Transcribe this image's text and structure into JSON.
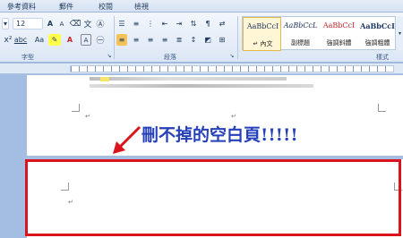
{
  "ribbon_tabs": [
    "參考資料",
    "郵件",
    "校閱",
    "檢視"
  ],
  "font": {
    "size": "12",
    "grow_label": "A",
    "shrink_label": "A",
    "format_label": "Aa",
    "clear_label": "A",
    "group_label": "字型"
  },
  "paragraph": {
    "group_label": "段落"
  },
  "styles": {
    "group_label": "樣式",
    "items": [
      {
        "sample": "AaBbCcI",
        "name": "↵ 內文"
      },
      {
        "sample": "AaBbCcL",
        "name": "副標題"
      },
      {
        "sample": "AaBbCcI",
        "name": "強調斜體"
      },
      {
        "sample": "AaBbCcI",
        "name": "強調粗體"
      }
    ]
  },
  "annotation": "刪不掉的空白頁!!!!!",
  "pilcrow": "↵",
  "colors": {
    "accent_red": "#d9141c",
    "annotation_blue": "#2540b8"
  }
}
